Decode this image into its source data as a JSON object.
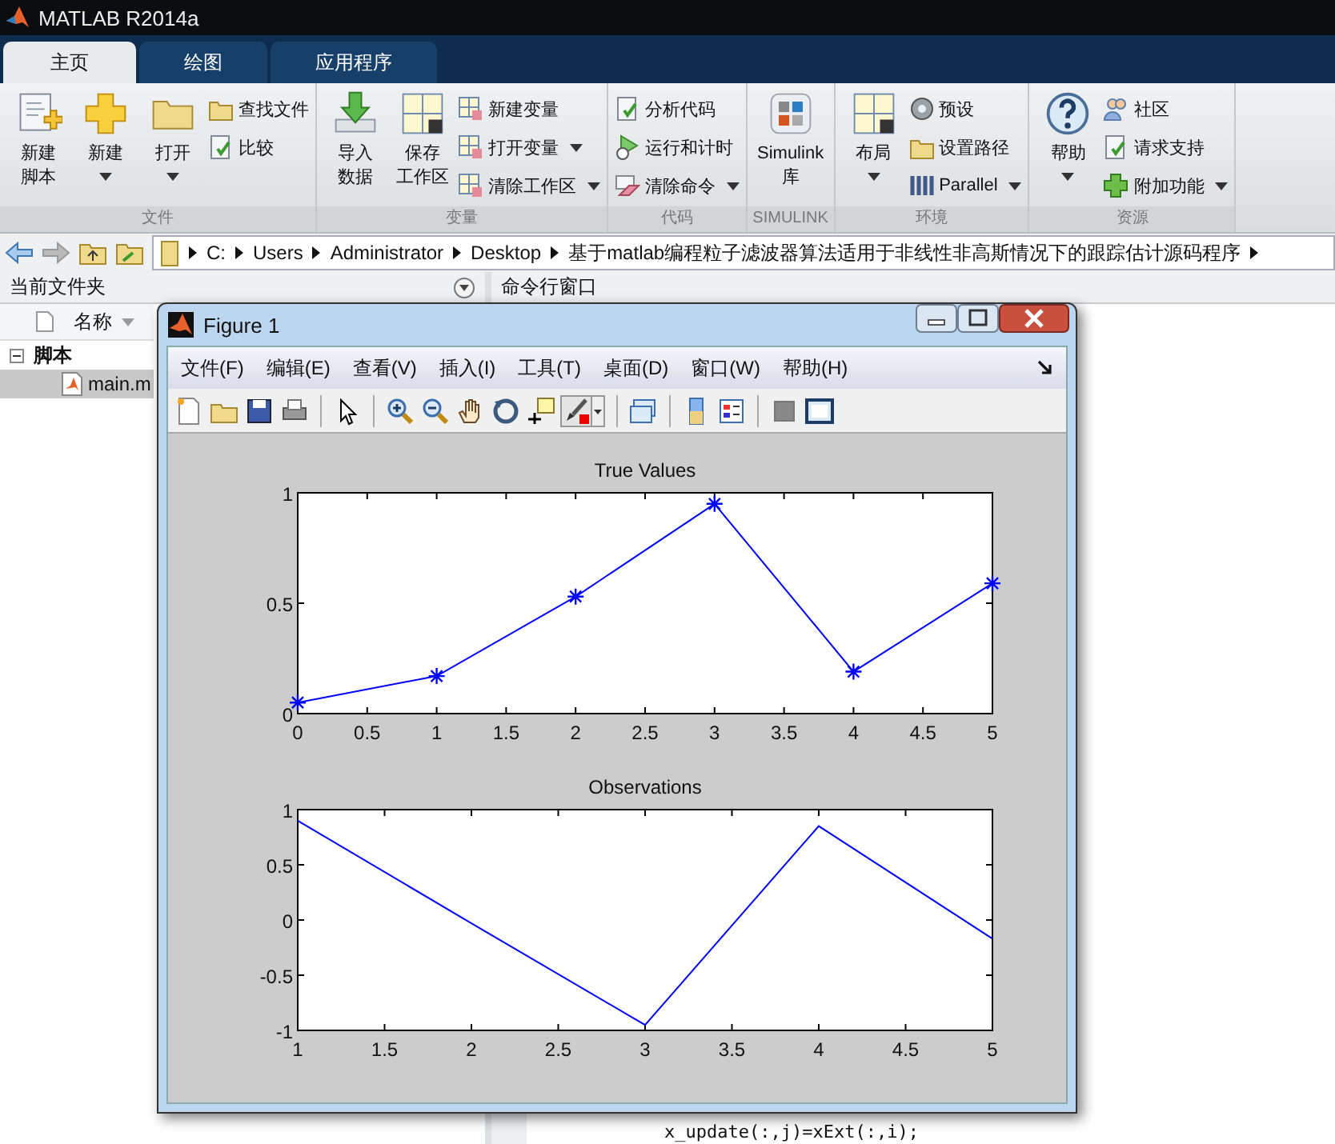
{
  "window": {
    "title": "MATLAB R2014a"
  },
  "tabs": [
    {
      "label": "主页",
      "selected": true
    },
    {
      "label": "绘图",
      "selected": false
    },
    {
      "label": "应用程序",
      "selected": false
    }
  ],
  "ribbon": {
    "groups": [
      {
        "label": "文件",
        "items": [
          {
            "kind": "large",
            "lines": [
              "新建",
              "脚本"
            ],
            "dropdown": false
          },
          {
            "kind": "large",
            "lines": [
              "新建"
            ],
            "dropdown": true
          },
          {
            "kind": "large",
            "lines": [
              "打开"
            ],
            "dropdown": true
          },
          {
            "kind": "small",
            "lines": [
              "查找文件"
            ],
            "dropdown": false
          },
          {
            "kind": "small",
            "lines": [
              "比较"
            ],
            "dropdown": false
          }
        ]
      },
      {
        "label": "变量",
        "items": [
          {
            "kind": "large",
            "lines": [
              "导入",
              "数据"
            ],
            "dropdown": false
          },
          {
            "kind": "large",
            "lines": [
              "保存",
              "工作区"
            ],
            "dropdown": false
          },
          {
            "kind": "small",
            "lines": [
              "新建变量"
            ],
            "dropdown": false
          },
          {
            "kind": "small",
            "lines": [
              "打开变量"
            ],
            "dropdown": true
          },
          {
            "kind": "small",
            "lines": [
              "清除工作区"
            ],
            "dropdown": true
          }
        ]
      },
      {
        "label": "代码",
        "items": [
          {
            "kind": "small",
            "lines": [
              "分析代码"
            ],
            "dropdown": false
          },
          {
            "kind": "small",
            "lines": [
              "运行和计时"
            ],
            "dropdown": false
          },
          {
            "kind": "small",
            "lines": [
              "清除命令"
            ],
            "dropdown": true
          }
        ]
      },
      {
        "label": "SIMULINK",
        "items": [
          {
            "kind": "large",
            "lines": [
              "Simulink",
              "库"
            ],
            "dropdown": false
          }
        ]
      },
      {
        "label": "环境",
        "items": [
          {
            "kind": "large",
            "lines": [
              "布局"
            ],
            "dropdown": true
          },
          {
            "kind": "small",
            "lines": [
              "预设"
            ],
            "dropdown": false
          },
          {
            "kind": "small",
            "lines": [
              "设置路径"
            ],
            "dropdown": false
          },
          {
            "kind": "small",
            "lines": [
              "Parallel"
            ],
            "dropdown": true
          }
        ]
      },
      {
        "label": "资源",
        "items": [
          {
            "kind": "large",
            "lines": [
              "帮助"
            ],
            "dropdown": true
          },
          {
            "kind": "small",
            "lines": [
              "社区"
            ],
            "dropdown": false
          },
          {
            "kind": "small",
            "lines": [
              "请求支持"
            ],
            "dropdown": false
          },
          {
            "kind": "small",
            "lines": [
              "附加功能"
            ],
            "dropdown": true
          }
        ]
      }
    ]
  },
  "address_bar": {
    "path": [
      "C:",
      "Users",
      "Administrator",
      "Desktop",
      "基于matlab编程粒子滤波器算法适用于非线性非高斯情况下的跟踪估计源码程序"
    ]
  },
  "current_folder": {
    "title": "当前文件夹",
    "column": "名称",
    "tree": [
      {
        "label": "脚本",
        "expanded": true,
        "children": [
          {
            "label": "main.m",
            "selected": true
          }
        ]
      }
    ]
  },
  "command_window": {
    "title": "命令行窗口",
    "lines": [
      "x_update(:,j)=xExt(:,i);"
    ]
  },
  "figure": {
    "title": "Figure 1",
    "menu": [
      "文件(F)",
      "编辑(E)",
      "查看(V)",
      "插入(I)",
      "工具(T)",
      "桌面(D)",
      "窗口(W)",
      "帮助(H)"
    ],
    "plots": [
      {
        "chart_data": {
          "type": "line",
          "title": "True Values",
          "x": [
            0,
            1,
            2,
            3,
            4,
            5
          ],
          "series": [
            {
              "color": "#0000ff",
              "values": [
                0.05,
                0.17,
                0.53,
                0.95,
                0.19,
                0.59
              ],
              "marker": "cross"
            }
          ],
          "xlim": [
            0,
            5
          ],
          "ylim": [
            0,
            1
          ],
          "xticks": [
            0,
            0.5,
            1,
            1.5,
            2,
            2.5,
            3,
            3.5,
            4,
            4.5,
            5
          ],
          "yticks": [
            0,
            0.5,
            1
          ]
        }
      },
      {
        "chart_data": {
          "type": "line",
          "title": "Observations",
          "x": [
            1,
            2,
            3,
            4,
            5
          ],
          "series": [
            {
              "color": "#0000ff",
              "values": [
                0.9,
                -0.03,
                -0.95,
                0.85,
                -0.17
              ]
            }
          ],
          "xlim": [
            1,
            5
          ],
          "ylim": [
            -1,
            1
          ],
          "xticks": [
            1,
            1.5,
            2,
            2.5,
            3,
            3.5,
            4,
            4.5,
            5
          ],
          "yticks": [
            -1,
            -0.5,
            0,
            0.5,
            1
          ]
        }
      }
    ]
  }
}
